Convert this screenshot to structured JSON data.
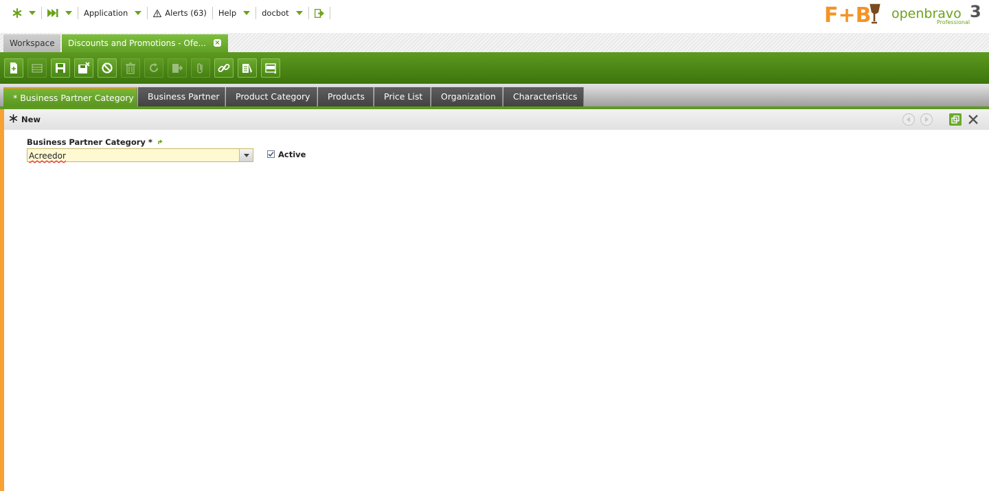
{
  "topnav": {
    "application_label": "Application",
    "alerts_label": "Alerts (63)",
    "help_label": "Help",
    "user_label": "docbot"
  },
  "brand": {
    "fb_text": "F+B",
    "ob_text": "openbravo",
    "ob_sub": "Professional",
    "ob_version": "3"
  },
  "main_tabs": {
    "workspace": "Workspace",
    "active": "Discounts and Promotions - Ofe..."
  },
  "sub_tabs": [
    "* Business Partner Category",
    "Business Partner",
    "Product Category",
    "Products",
    "Price List",
    "Organization",
    "Characteristics"
  ],
  "status": {
    "mode": "New"
  },
  "form": {
    "bp_category_label": "Business Partner Category *",
    "bp_category_value": "Acreedor",
    "active_label": "Active",
    "active_checked": true
  },
  "colors": {
    "accent_green": "#5d9a20",
    "accent_orange": "#f7a034",
    "required_field_bg": "#fff9d2"
  }
}
